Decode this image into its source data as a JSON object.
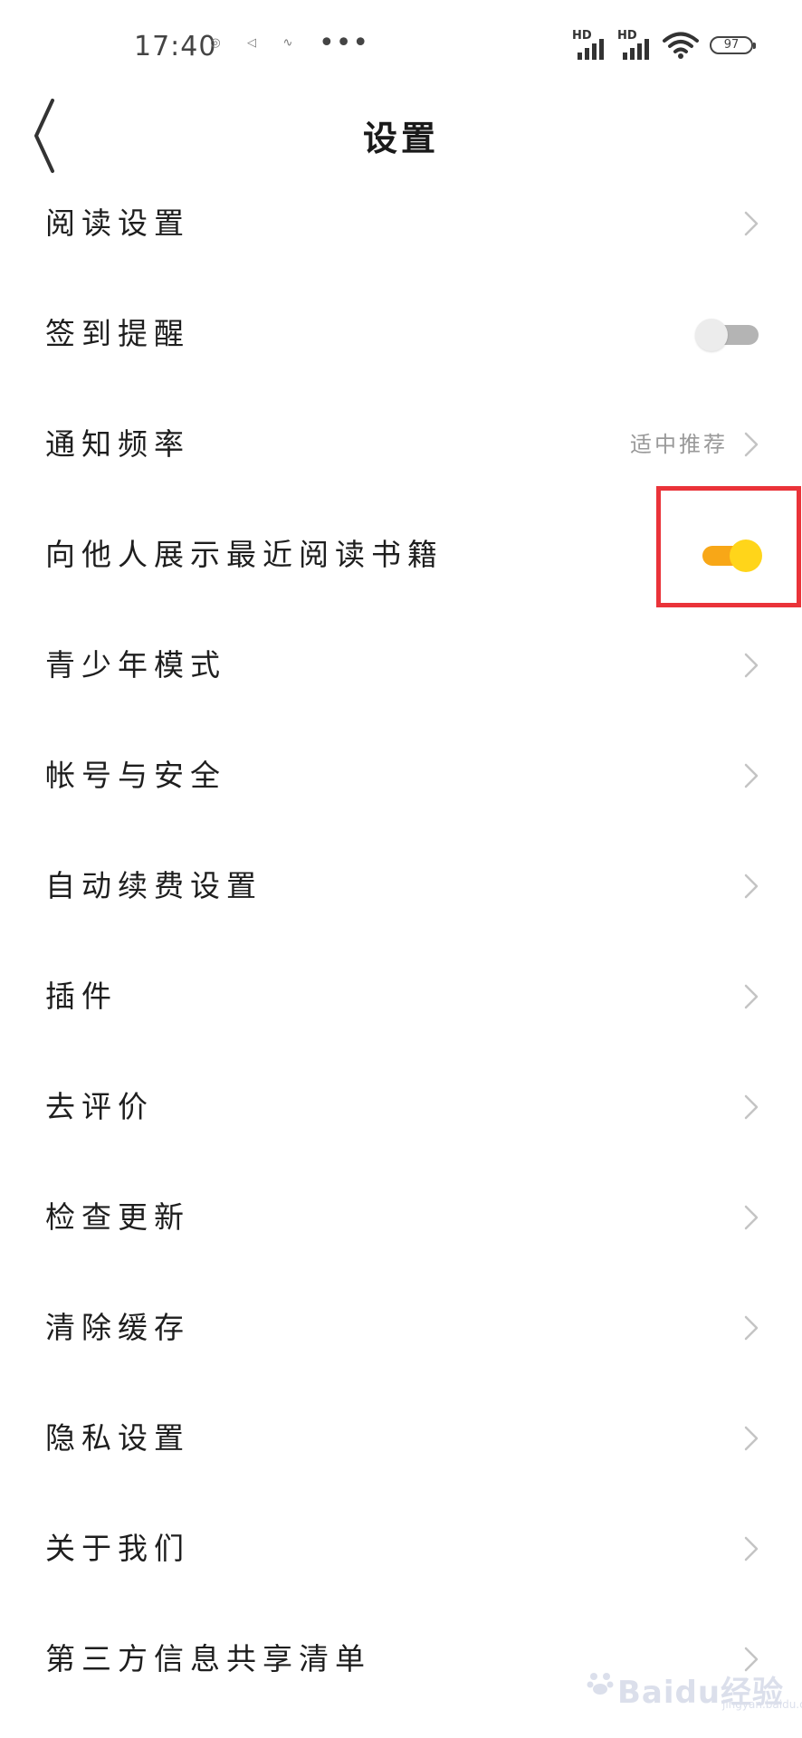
{
  "status_bar": {
    "time": "17:40",
    "more": "•••",
    "signal1_label": "HD",
    "signal2_label": "HD",
    "battery": "97"
  },
  "header": {
    "title": "设置"
  },
  "settings": {
    "items": [
      {
        "label": "阅读设置"
      },
      {
        "label": "签到提醒",
        "toggle": "off"
      },
      {
        "label": "通知频率",
        "value": "适中推荐"
      },
      {
        "label": "向他人展示最近阅读书籍",
        "toggle": "on"
      },
      {
        "label": "青少年模式"
      },
      {
        "label": "帐号与安全"
      },
      {
        "label": "自动续费设置"
      },
      {
        "label": "插件"
      },
      {
        "label": "去评价"
      },
      {
        "label": "检查更新"
      },
      {
        "label": "清除缓存"
      },
      {
        "label": "隐私设置"
      },
      {
        "label": "关于我们"
      },
      {
        "label": "第三方信息共享清单"
      }
    ]
  },
  "watermark": {
    "brand": "Baidu经验",
    "url": "jingyan.baidu.com"
  },
  "colors": {
    "toggle_on_track": "#f8a717",
    "toggle_on_knob": "#ffd51a",
    "highlight_box": "#ea3339"
  }
}
